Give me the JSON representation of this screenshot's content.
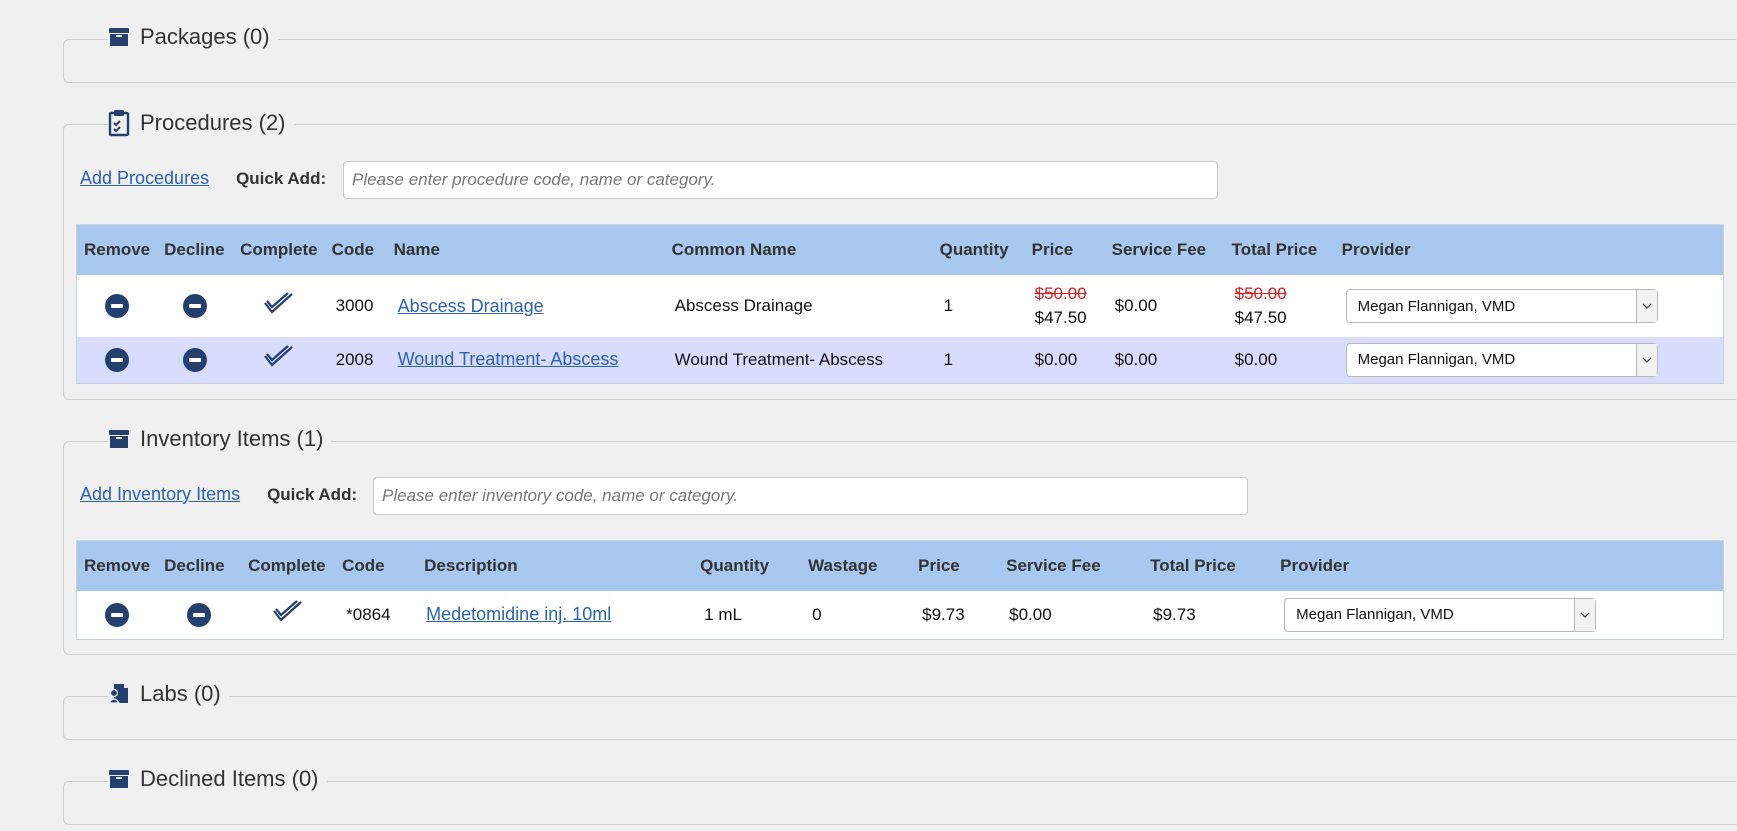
{
  "packages": {
    "title": "Packages (0)",
    "icon": "box-icon"
  },
  "procedures": {
    "title": "Procedures (2)",
    "icon": "clipboard-check-icon",
    "add_link": "Add Procedures",
    "quick_add_label": "Quick Add:",
    "quick_add_placeholder": "Please enter procedure code, name or category.",
    "columns": [
      "Remove",
      "Decline",
      "Complete",
      "Code",
      "Name",
      "Common Name",
      "Quantity",
      "Price",
      "Service Fee",
      "Total Price",
      "Provider"
    ],
    "rows": [
      {
        "code": "3000",
        "name": "Abscess Drainage",
        "common_name": "Abscess Drainage",
        "quantity": "1",
        "price_original": "$50.00",
        "price": "$47.50",
        "service_fee": "$0.00",
        "total_original": "$50.00",
        "total": "$47.50",
        "provider": "Megan Flannigan, VMD"
      },
      {
        "code": "2008",
        "name": "Wound Treatment- Abscess",
        "common_name": "Wound Treatment- Abscess",
        "quantity": "1",
        "price": "$0.00",
        "service_fee": "$0.00",
        "total": "$0.00",
        "provider": "Megan Flannigan, VMD"
      }
    ]
  },
  "inventory": {
    "title": "Inventory Items (1)",
    "icon": "box-icon",
    "add_link": "Add Inventory Items",
    "quick_add_label": "Quick Add:",
    "quick_add_placeholder": "Please enter inventory code, name or category.",
    "columns": [
      "Remove",
      "Decline",
      "Complete",
      "Code",
      "Description",
      "Quantity",
      "Wastage",
      "Price",
      "Service Fee",
      "Total Price",
      "Provider"
    ],
    "rows": [
      {
        "code": "*0864",
        "description": "Medetomidine inj. 10ml",
        "quantity": "1 mL",
        "wastage": "0",
        "price": "$9.73",
        "service_fee": "$0.00",
        "total": "$9.73",
        "provider": "Megan Flannigan, VMD"
      }
    ]
  },
  "labs": {
    "title": "Labs (0)",
    "icon": "lab-report-icon"
  },
  "declined": {
    "title": "Declined Items (0)",
    "icon": "box-icon"
  },
  "colors": {
    "header_bg": "#a9c8ef",
    "alt_row": "#d8dcfd",
    "link": "#2a62b3",
    "icon": "#24406f",
    "strike": "#d62020"
  }
}
